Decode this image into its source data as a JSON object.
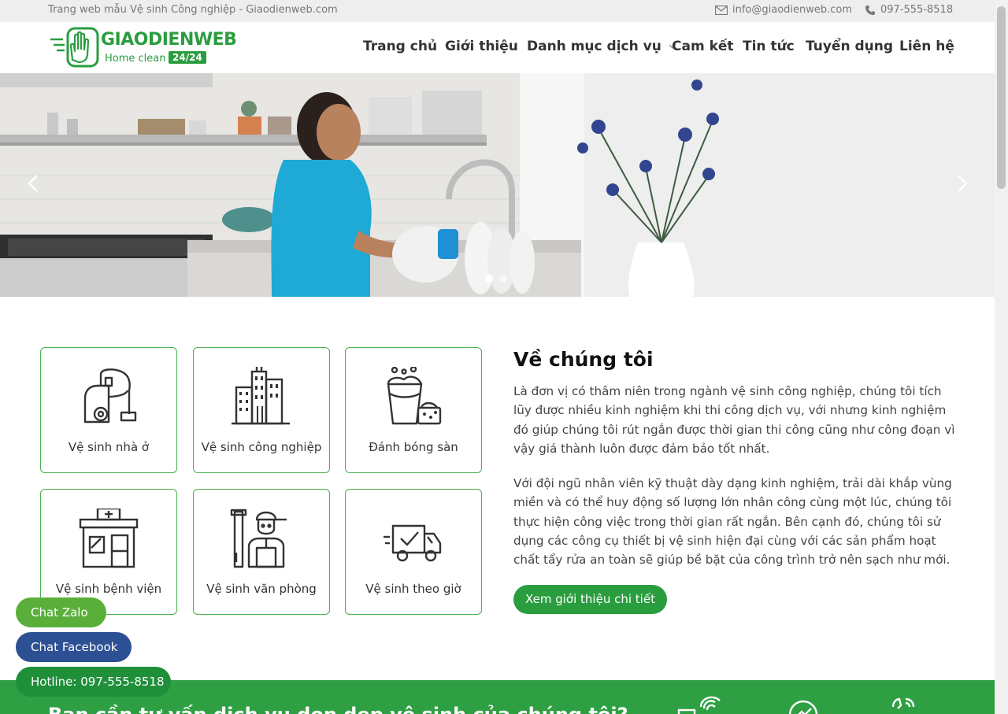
{
  "topbar": {
    "tagline": "Trang web mẫu Vệ sinh Công nghiệp - Giaodienweb.com",
    "email": "info@giaodienweb.com",
    "phone": "097-555-8518",
    "email_icon": "envelope-icon",
    "phone_icon": "phone-icon"
  },
  "logo": {
    "brand": "GIAODIENWEB",
    "sub": "Home clean",
    "badge": "24/24"
  },
  "nav": {
    "items": [
      {
        "label": "Trang chủ"
      },
      {
        "label": "Giới thiệu"
      },
      {
        "label": "Danh mục dịch vụ"
      },
      {
        "label": "Cam kết"
      },
      {
        "label": "Tin tức"
      },
      {
        "label": "Tuyển dụng"
      },
      {
        "label": "Liên hệ"
      }
    ]
  },
  "hero": {
    "prev_icon": "chevron-left-icon",
    "next_icon": "chevron-right-icon",
    "dots": 2,
    "active_dot": 0
  },
  "services": [
    {
      "label": "Vệ sinh nhà ở",
      "icon": "vacuum-cleaner-icon"
    },
    {
      "label": "Vệ sinh công nghiệp",
      "icon": "buildings-icon"
    },
    {
      "label": "Đánh bóng sàn",
      "icon": "bucket-sponge-icon"
    },
    {
      "label": "Vệ sinh bệnh viện",
      "icon": "hospital-icon"
    },
    {
      "label": "Vệ sinh văn phòng",
      "icon": "worker-icon"
    },
    {
      "label": "Vệ sinh theo giờ",
      "icon": "delivery-truck-icon"
    }
  ],
  "about": {
    "title": "Về chúng tôi",
    "p1": "Là đơn vị có thâm niên trong ngành vệ sinh công nghiệp, chúng tôi tích lũy được nhiều kinh nghiệm khi thi công dịch vụ, với nhưng kinh nghiệm đó giúp chúng tôi rút ngắn được thời gian thi công cũng như công đoạn vì vậy giá thành luôn được đảm bảo tốt nhất.",
    "p2": "Với đội ngũ nhân viên kỹ thuật dày dạng kinh nghiệm, trải dài khắp vùng miền và có thể huy động số lượng lớn nhân công cùng một lúc, chúng tôi thực hiện công việc trong thời gian rất ngắn. Bên cạnh đó, chúng tôi sử dụng các công cụ thiết bị vệ sinh hiện đại cùng với các sản phẩm hoạt chất tẩy rửa an toàn sẽ giúp bề bặt của công trình trở nên sạch như mới.",
    "button": "Xem giới thiệu chi tiết"
  },
  "band": {
    "title": "Bạn cần tư vấn dịch vụ dọn dẹp vệ sinh của chúng tôi?"
  },
  "floating": {
    "zalo": "Chat Zalo",
    "facebook": "Chat Facebook",
    "hotline": "Hotline: 097-555-8518"
  },
  "colors": {
    "brand_green": "#2a9d3f",
    "card_border": "#4caf50",
    "zalo": "#5aaf3b",
    "facebook": "#2d4f94"
  }
}
